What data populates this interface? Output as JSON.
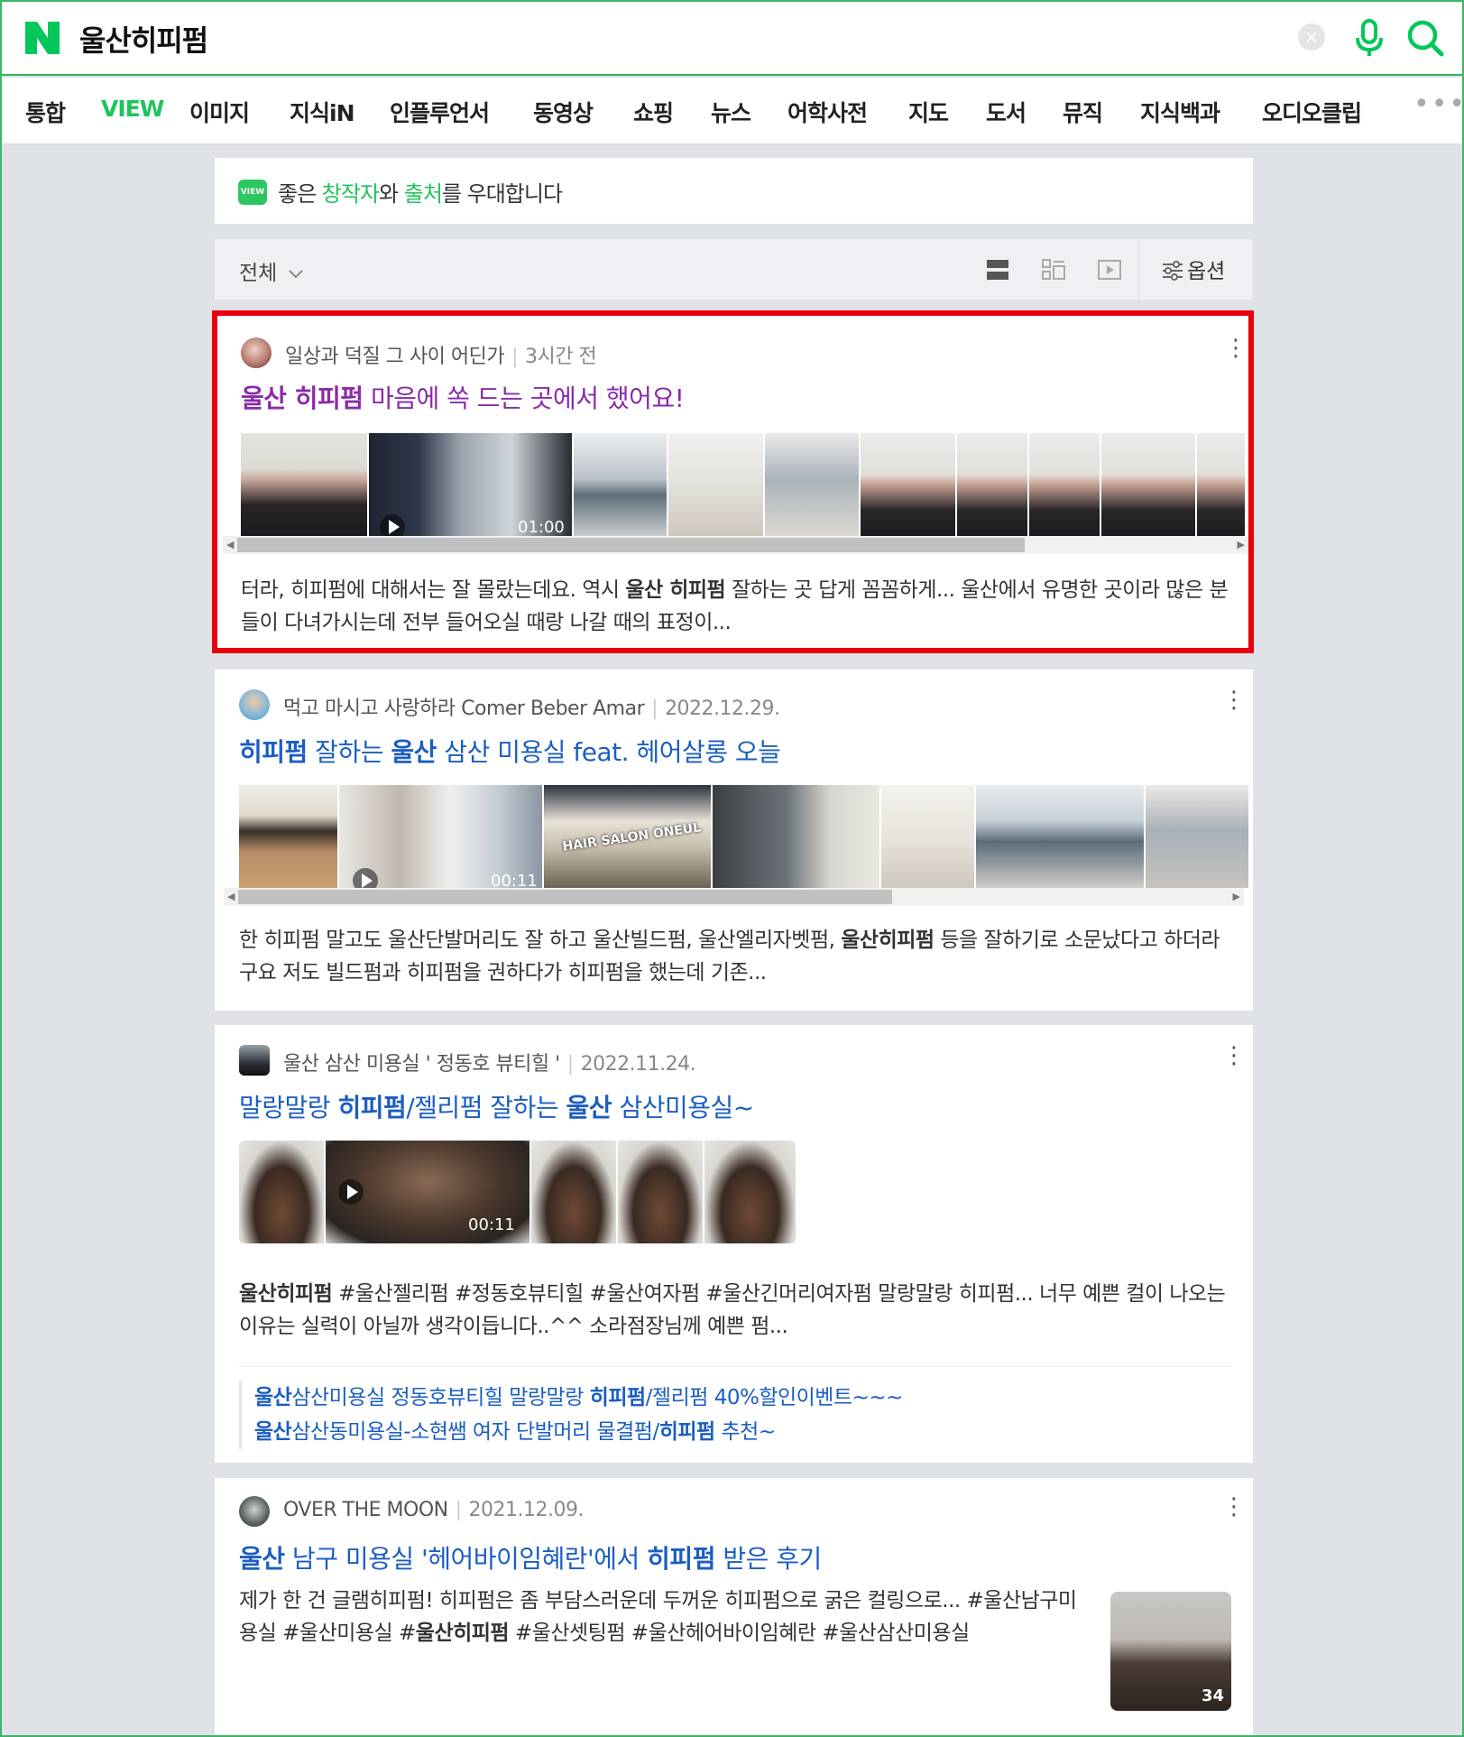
{
  "search": {
    "query": "울산히피펌",
    "clear_icon": "×"
  },
  "tabs": [
    "통합",
    "VIEW",
    "이미지",
    "지식iN",
    "인플루언서",
    "동영상",
    "쇼핑",
    "뉴스",
    "어학사전",
    "지도",
    "도서",
    "뮤직",
    "지식백과",
    "오디오클립"
  ],
  "tabs_more": "•••",
  "active_tab": "VIEW",
  "notice": {
    "badge": "VIEW",
    "prefix": "좋은 ",
    "creator": "창작자",
    "mid": "와 ",
    "source": "출처",
    "suffix": "를 우대합니다"
  },
  "filter": {
    "all_label": "전체",
    "options_label": "옵션"
  },
  "colors": {
    "brand_green": "#03c75a",
    "link_blue": "#1b5ec1",
    "visited_purple": "#8a2ba8",
    "highlight_red": "#e8000a"
  },
  "results": [
    {
      "author": "일상과 덕질 그 사이 어딘가",
      "time": "3시간 전",
      "title_parts": [
        {
          "t": "울산 히피펌",
          "b": true
        },
        {
          "t": " 마음에 쏙 드는 곳에서 했어요!",
          "b": false
        }
      ],
      "desc_parts": [
        {
          "t": "터라, 히피펌에 대해서는 잘 몰랐는데요. 역시 ",
          "b": false
        },
        {
          "t": "울산 히피펌",
          "b": true
        },
        {
          "t": " 잘하는 곳 답게 꼼꼼하게... 울산에서 유명한 곳이라 많은 분들이 다녀가시는데 전부 들어오실 때랑 나갈 때의 표정이...",
          "b": false
        }
      ],
      "video_duration": "01:00",
      "scroll_fill": 0.79
    },
    {
      "author": "먹고 마시고 사랑하라 Comer Beber Amar",
      "time": "2022.12.29.",
      "title_parts": [
        {
          "t": "히피펌",
          "b": true
        },
        {
          "t": " 잘하는 ",
          "b": false
        },
        {
          "t": "울산",
          "b": true
        },
        {
          "t": " 삼산 미용실 feat. 헤어살롱 오늘",
          "b": false
        }
      ],
      "desc_parts": [
        {
          "t": "한 히피펌 말고도 울산단발머리도 잘 하고 울산빌드펌, 울산엘리자벳펌, ",
          "b": false
        },
        {
          "t": "울산히피펌",
          "b": true
        },
        {
          "t": " 등을 잘하기로 소문났다고 하더라구요 저도 빌드펌과 히피펌을 권하다가 히피펌을 했는데 기존...",
          "b": false
        }
      ],
      "video_duration": "00:11",
      "salon_sign": "HAIR SALON ONEUL",
      "scroll_fill": 0.66
    },
    {
      "author": "울산 삼산 미용실 ' 정동호 뷰티힐 '",
      "time": "2022.11.24.",
      "title_parts": [
        {
          "t": "말랑말랑 ",
          "b": false
        },
        {
          "t": "히피펌",
          "b": true
        },
        {
          "t": "/젤리펌 잘하는 ",
          "b": false
        },
        {
          "t": "울산",
          "b": true
        },
        {
          "t": " 삼산미용실~",
          "b": false
        }
      ],
      "desc_parts": [
        {
          "t": "울산히피펌",
          "b": true
        },
        {
          "t": " #울산젤리펌 #정동호뷰티힐 #울산여자펌 #울산긴머리여자펌 말랑말랑 히피펌... 너무 예쁜 컬이 나오는 이유는 실력이 아닐까 생각이듭니다..^^ 소라점장님께 예쁜 펌...",
          "b": false
        }
      ],
      "video_duration": "00:11",
      "related": [
        [
          {
            "t": "울산",
            "b": true
          },
          {
            "t": "삼산미용실 정동호뷰티힐 말랑말랑 ",
            "b": false
          },
          {
            "t": "히피펌",
            "b": true
          },
          {
            "t": "/젤리펌 40%할인이벤트~~~",
            "b": false
          }
        ],
        [
          {
            "t": "울산",
            "b": true
          },
          {
            "t": "삼산동미용실-소현쌤 여자 단발머리 물결펌/",
            "b": false
          },
          {
            "t": "히피펌",
            "b": true
          },
          {
            "t": " 추천~",
            "b": false
          }
        ]
      ]
    },
    {
      "author": "OVER THE MOON",
      "time": "2021.12.09.",
      "title_parts": [
        {
          "t": "울산",
          "b": true
        },
        {
          "t": " 남구 미용실 '헤어바이임혜란'에서 ",
          "b": false
        },
        {
          "t": "히피펌",
          "b": true
        },
        {
          "t": " 받은 후기",
          "b": false
        }
      ],
      "desc_parts": [
        {
          "t": "제가 한 건 글램히피펌! 히피펌은 좀 부담스러운데 두꺼운 히피펌으로 굵은 컬링으로... #울산남구미용실 #울산미용실 #",
          "b": false
        },
        {
          "t": "울산히피펌",
          "b": true
        },
        {
          "t": " #울산셋팅펌 #울산헤어바이임혜란 #울산삼산미용실",
          "b": false
        }
      ],
      "thumb_count": "34"
    }
  ]
}
